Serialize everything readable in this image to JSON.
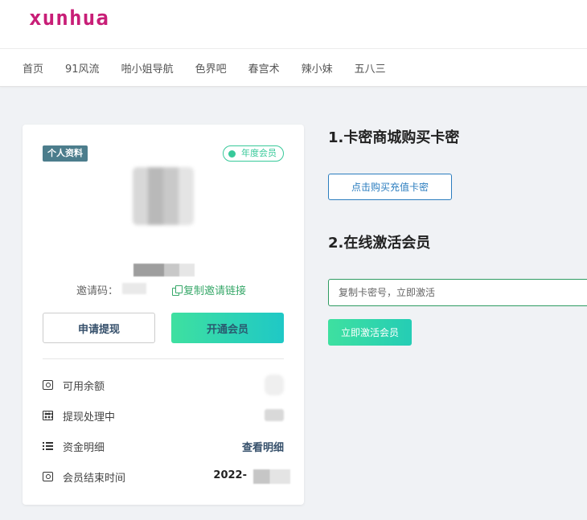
{
  "header": {
    "logo": "xunhua",
    "nav": [
      "首页",
      "91风流",
      "啪小姐导航",
      "色界吧",
      "春宫术",
      "辣小妹",
      "五八三"
    ]
  },
  "profile": {
    "tag": "个人资料",
    "member_badge": "年度会员",
    "invite_label": "邀请码：",
    "copy_link": "复制邀请链接",
    "withdraw_button": "申请提现",
    "open_member_button": "开通会员",
    "stats": {
      "balance_label": "可用余额",
      "processing_label": "提现处理中",
      "details_label": "资金明细",
      "details_link": "查看明细",
      "expire_label": "会员结束时间",
      "expire_value": "2022-"
    }
  },
  "steps": {
    "step1_title": "1.卡密商城购买卡密",
    "buy_button": "点击购买充值卡密",
    "step2_title": "2.在线激活会员",
    "input_placeholder": "复制卡密号，立即激活",
    "activate_button": "立即激活会员"
  },
  "colors": {
    "brand": "#c81e77",
    "accent_green": "#38c99a",
    "link_blue": "#2b7dbf"
  }
}
